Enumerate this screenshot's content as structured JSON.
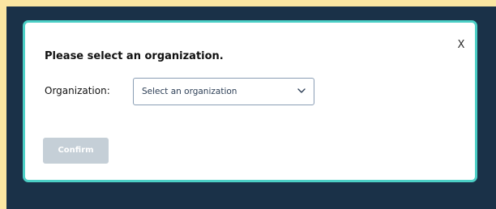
{
  "dialog": {
    "title": "Please select an organization.",
    "close_label": "X",
    "organization_label": "Organization:",
    "select": {
      "value": "Select an organization",
      "icon": "chevron-down-icon"
    },
    "confirm_label": "Confirm",
    "confirm_disabled": true
  },
  "colors": {
    "page_background": "#fbe6a2",
    "backdrop": "#1a3148",
    "dialog_border": "#4ccfc6",
    "confirm_disabled_bg": "#c5cfd7"
  }
}
